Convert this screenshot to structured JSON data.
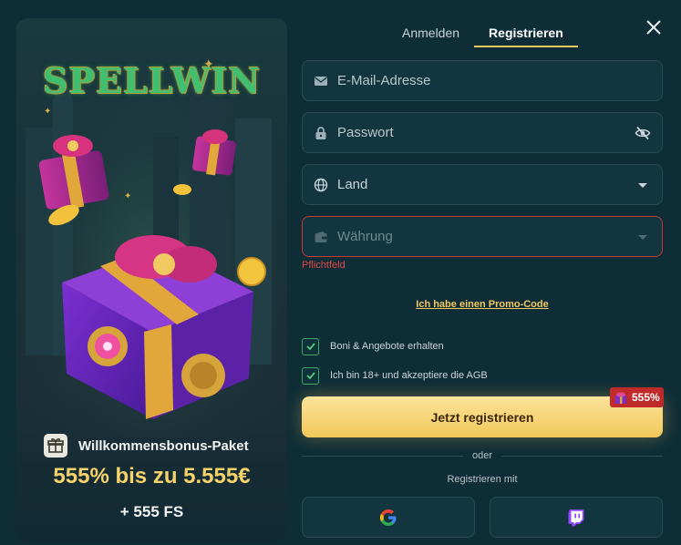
{
  "promo": {
    "logo_text": "SPELLWIN",
    "bonus_title": "Willkommensbonus-Paket",
    "bonus_amount": "555% bis zu 5.555€",
    "bonus_spins": "+ 555 FS"
  },
  "tabs": [
    {
      "label": "Anmelden",
      "active": false
    },
    {
      "label": "Registrieren",
      "active": true
    }
  ],
  "form": {
    "email_placeholder": "E-Mail-Adresse",
    "password_placeholder": "Passwort",
    "country_label": "Land",
    "currency_label": "Währung",
    "currency_error": "Pflichtfeld",
    "promo_link": "Ich habe einen Promo-Code",
    "checkbox_offers": "Boni & Angebote erhalten",
    "checkbox_terms": "Ich bin 18+ und akzeptiere die AGB",
    "submit_label": "Jetzt registrieren",
    "submit_badge": "555%",
    "divider_text": "oder",
    "register_with": "Registrieren mit"
  },
  "colors": {
    "accent_gold": "#f0c960",
    "error_red": "#e04848",
    "check_green": "#3fa863",
    "twitch_purple": "#9146ff"
  },
  "icons": {
    "email": "mail-icon",
    "password": "lock-icon",
    "visibility": "eye-off-icon",
    "country": "globe-icon",
    "currency": "wallet-icon",
    "dropdown": "chevron-down-icon",
    "close": "close-icon",
    "google": "google-icon",
    "twitch": "twitch-icon"
  }
}
